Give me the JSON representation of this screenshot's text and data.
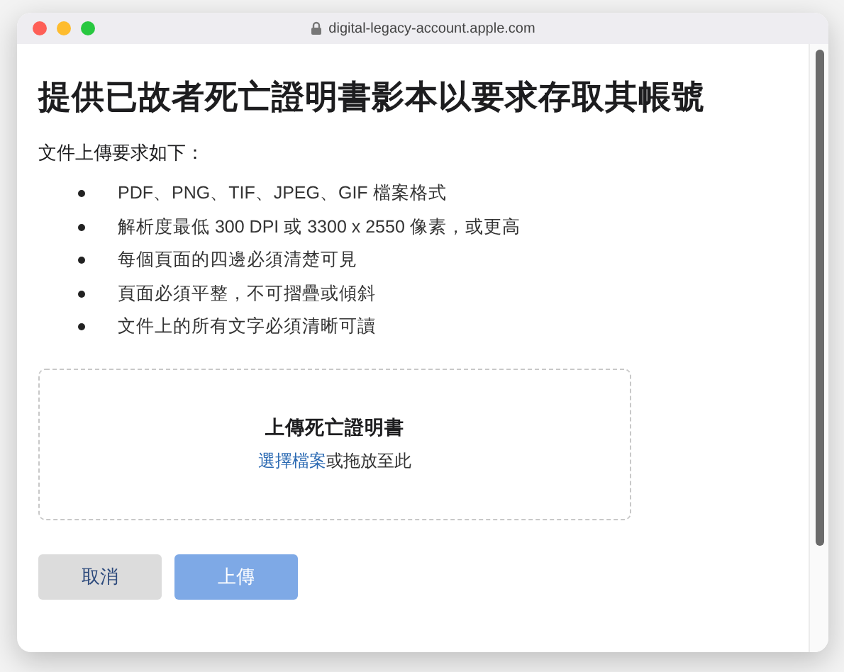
{
  "window": {
    "url": "digital-legacy-account.apple.com"
  },
  "heading": "提供已故者死亡證明書影本以要求存取其帳號",
  "intro": "文件上傳要求如下：",
  "requirements": [
    "PDF、PNG、TIF、JPEG、GIF 檔案格式",
    "解析度最低 300 DPI 或 3300 x 2550 像素，或更高",
    "每個頁面的四邊必須清楚可見",
    "頁面必須平整，不可摺疊或傾斜",
    "文件上的所有文字必須清晰可讀"
  ],
  "dropzone": {
    "title": "上傳死亡證明書",
    "link": "選擇檔案",
    "hint": "或拖放至此"
  },
  "buttons": [
    {
      "label": "取消",
      "kind": "secondary",
      "disabled": false
    },
    {
      "label": "上傳",
      "kind": "primary",
      "disabled": true
    }
  ]
}
